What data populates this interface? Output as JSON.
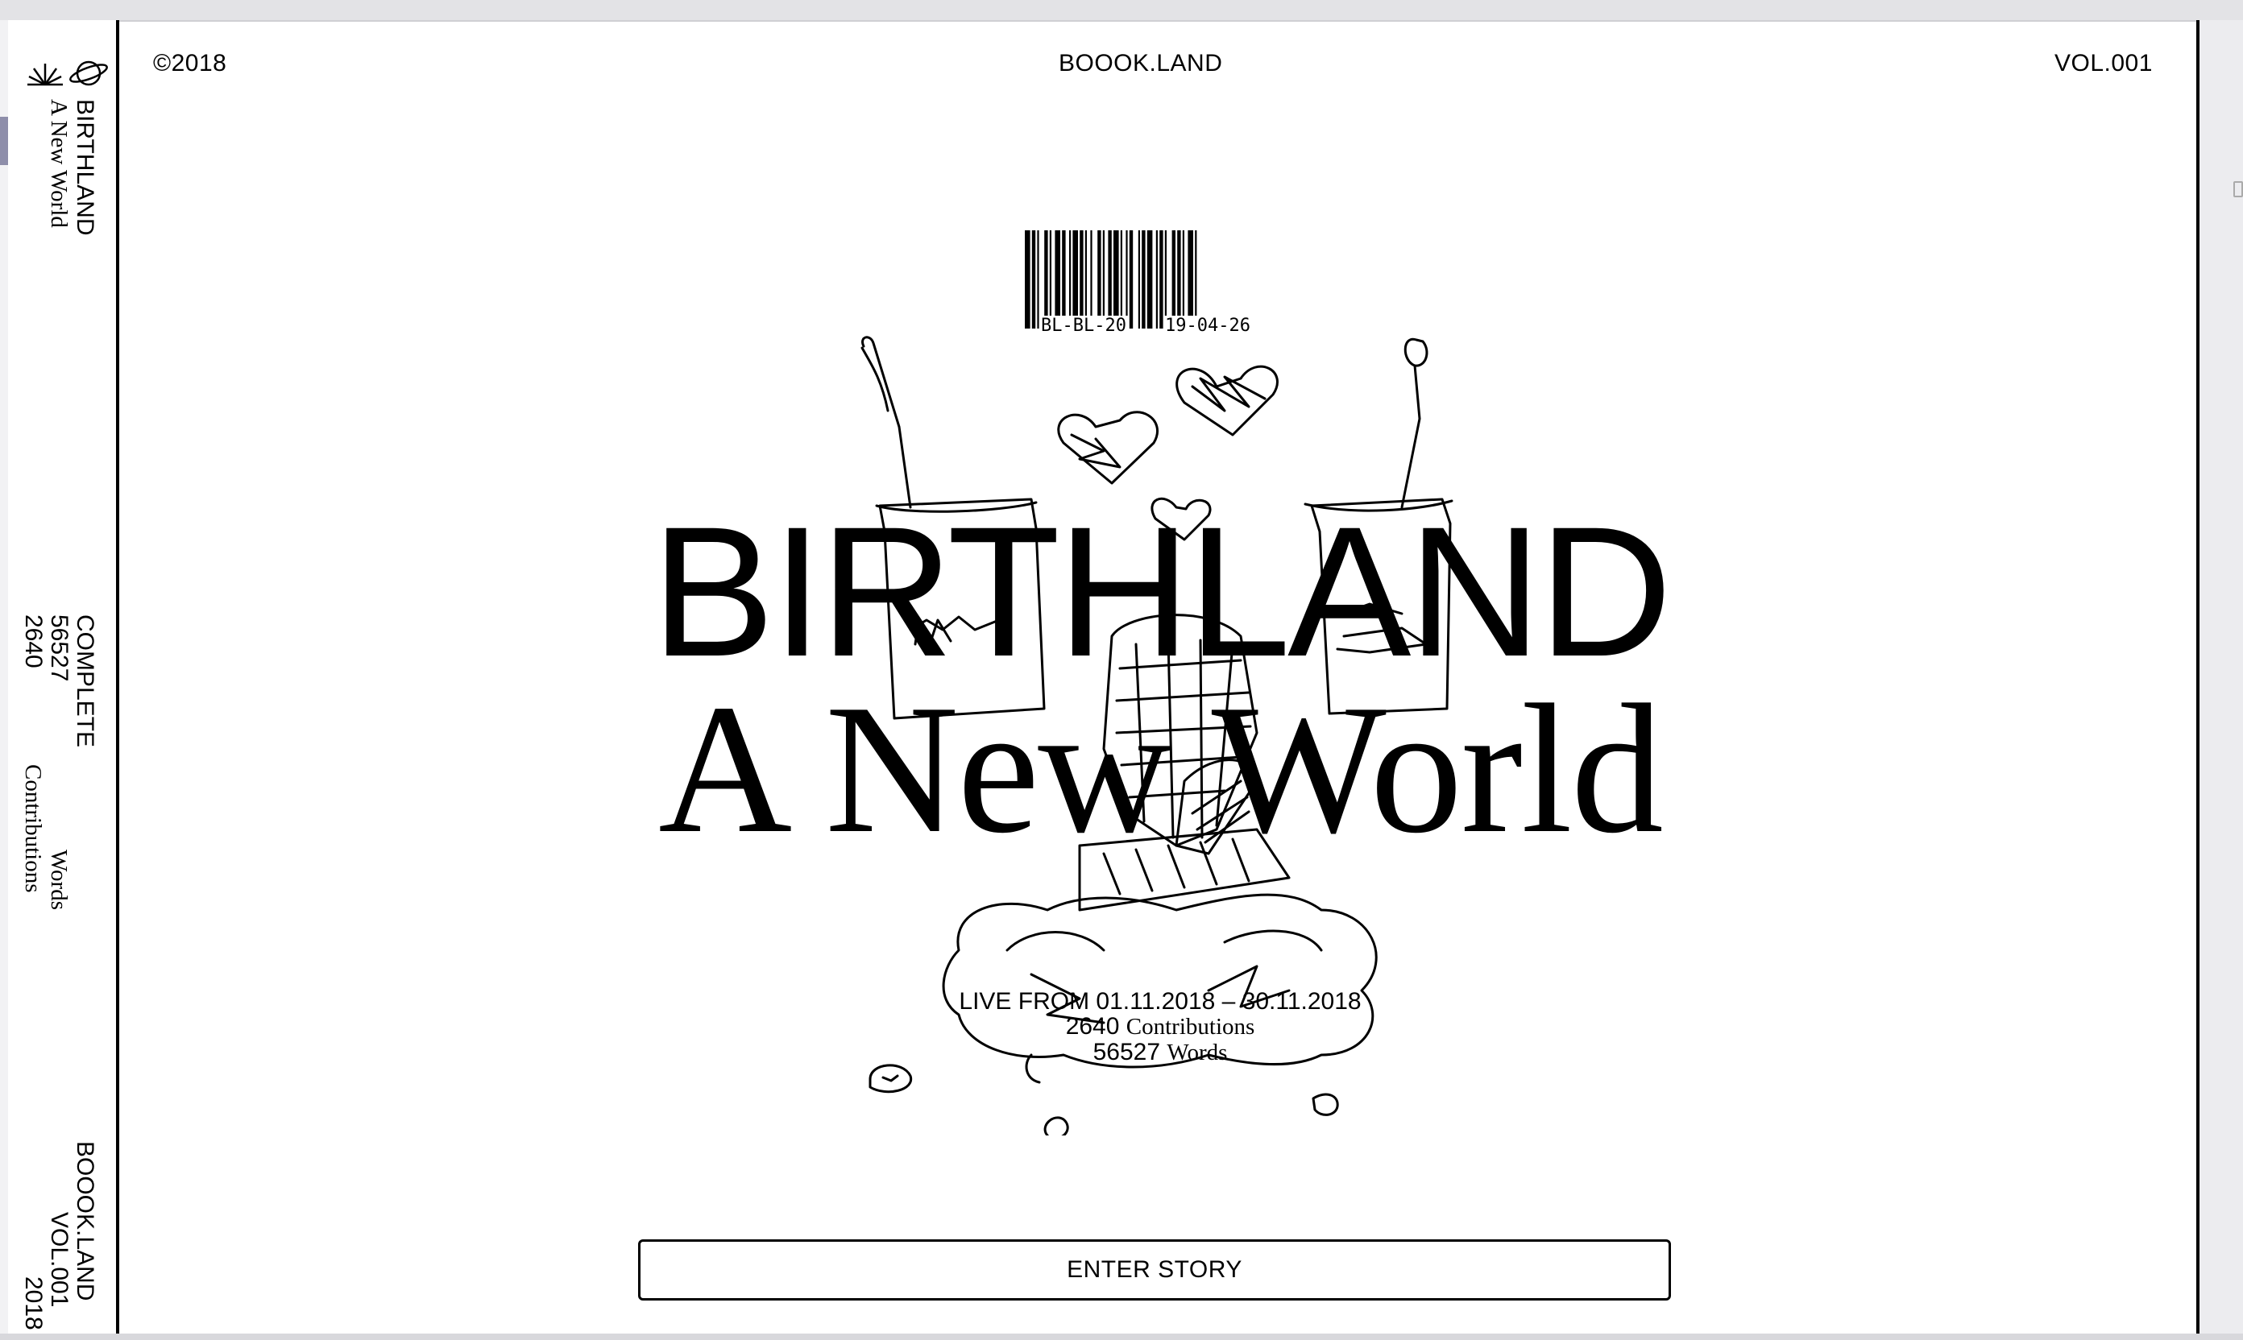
{
  "sidebar": {
    "title": "BIRTHLAND",
    "subtitle": "A New World",
    "status": "COMPLETE",
    "word_count": "56527",
    "contribution_count": "2640",
    "words_label": "Words",
    "contributions_label": "Contributions",
    "site": "BOOOK.LAND",
    "volume": "VOL.001",
    "year": "2018",
    "icons": [
      "grass-icon",
      "planet-icon"
    ]
  },
  "header": {
    "copyright": "©2018",
    "site": "BOOOK.LAND",
    "volume": "VOL.001"
  },
  "hero": {
    "barcode_left": "BL-BL-20",
    "barcode_right": "19-04-26",
    "title": "BIRTHLAND",
    "subtitle": "A New World",
    "live_dates": "LIVE FROM 01.11.2018 – 30.11.2018",
    "contributions_value": "2640",
    "contributions_label": "Contributions",
    "words_value": "56527",
    "words_label": "Words",
    "illustration": "doodle-illustration"
  },
  "cta": {
    "label": "ENTER STORY"
  }
}
